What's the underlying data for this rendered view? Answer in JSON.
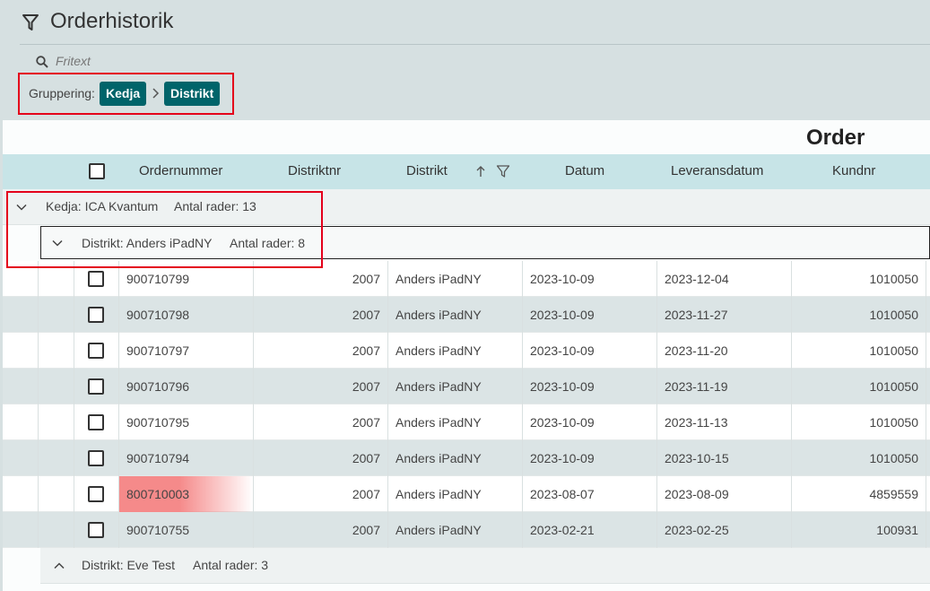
{
  "header": {
    "title": "Orderhistorik",
    "search_placeholder": "Fritext"
  },
  "grouping": {
    "label": "Gruppering:",
    "chips": [
      "Kedja",
      "Distrikt"
    ]
  },
  "grid": {
    "title": "Order",
    "columns": [
      "Ordernummer",
      "Distriktnr",
      "Distrikt",
      "Datum",
      "Leveransdatum",
      "Kundnr"
    ],
    "sorted_column": "Distrikt",
    "sort_direction": "ascending",
    "group_kedja": {
      "label": "Kedja: ICA Kvantum",
      "count": "Antal rader: 13"
    },
    "group_distrikt_1": {
      "label": "Distrikt: Anders iPadNY",
      "count": "Antal rader: 8"
    },
    "group_distrikt_2": {
      "label": "Distrikt: Eve Test",
      "count": "Antal rader: 3"
    },
    "rows": [
      {
        "ordernummer": "900710799",
        "distriktnr": "2007",
        "distrikt": "Anders iPadNY",
        "datum": "2023-10-09",
        "leveransdatum": "2023-12-04",
        "kundnr": "1010050"
      },
      {
        "ordernummer": "900710798",
        "distriktnr": "2007",
        "distrikt": "Anders iPadNY",
        "datum": "2023-10-09",
        "leveransdatum": "2023-11-27",
        "kundnr": "1010050"
      },
      {
        "ordernummer": "900710797",
        "distriktnr": "2007",
        "distrikt": "Anders iPadNY",
        "datum": "2023-10-09",
        "leveransdatum": "2023-11-20",
        "kundnr": "1010050"
      },
      {
        "ordernummer": "900710796",
        "distriktnr": "2007",
        "distrikt": "Anders iPadNY",
        "datum": "2023-10-09",
        "leveransdatum": "2023-11-19",
        "kundnr": "1010050"
      },
      {
        "ordernummer": "900710795",
        "distriktnr": "2007",
        "distrikt": "Anders iPadNY",
        "datum": "2023-10-09",
        "leveransdatum": "2023-11-13",
        "kundnr": "1010050"
      },
      {
        "ordernummer": "900710794",
        "distriktnr": "2007",
        "distrikt": "Anders iPadNY",
        "datum": "2023-10-09",
        "leveransdatum": "2023-10-15",
        "kundnr": "1010050"
      },
      {
        "ordernummer": "800710003",
        "distriktnr": "2007",
        "distrikt": "Anders iPadNY",
        "datum": "2023-08-07",
        "leveransdatum": "2023-08-09",
        "kundnr": "4859559"
      },
      {
        "ordernummer": "900710755",
        "distriktnr": "2007",
        "distrikt": "Anders iPadNY",
        "datum": "2023-02-21",
        "leveransdatum": "2023-02-25",
        "kundnr": "100931"
      }
    ],
    "highlighted_row": 6
  },
  "colors": {
    "accent": "#00646a",
    "header_bg": "#c7e4e7",
    "annotation_red": "#e4001b",
    "highlight": "#f58a8a"
  },
  "icons": [
    "filter-icon",
    "search-icon",
    "chevron-right-icon",
    "sort-up-icon",
    "column-filter-icon",
    "chevron-down-icon",
    "chevron-up-icon"
  ]
}
